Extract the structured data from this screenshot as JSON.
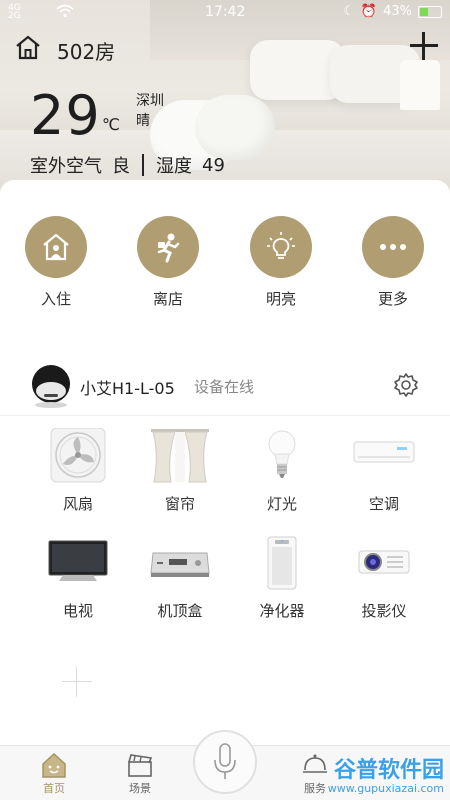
{
  "status_bar": {
    "network_top": "4G",
    "network_bottom": "2G",
    "time": "17:42",
    "battery": "43%",
    "battery_level": 0.43
  },
  "header": {
    "room": "502房"
  },
  "weather": {
    "temperature": "29",
    "unit": "℃",
    "city": "深圳",
    "condition": "晴",
    "air_label": "室外空气",
    "air_value": "良",
    "humidity_label": "湿度",
    "humidity_value": "49"
  },
  "scenes": [
    {
      "label": "入住",
      "icon": "house-person-icon"
    },
    {
      "label": "离店",
      "icon": "running-person-icon"
    },
    {
      "label": "明亮",
      "icon": "lightbulb-icon"
    },
    {
      "label": "更多",
      "icon": "more-dots-icon"
    }
  ],
  "device": {
    "name": "小艾H1-L-05",
    "status": "设备在线"
  },
  "appliances": [
    {
      "label": "风扇",
      "icon": "fan-icon"
    },
    {
      "label": "窗帘",
      "icon": "curtain-icon"
    },
    {
      "label": "灯光",
      "icon": "bulb-icon"
    },
    {
      "label": "空调",
      "icon": "air-conditioner-icon"
    },
    {
      "label": "电视",
      "icon": "tv-icon"
    },
    {
      "label": "机顶盒",
      "icon": "set-top-box-icon"
    },
    {
      "label": "净化器",
      "icon": "air-purifier-icon"
    },
    {
      "label": "投影仪",
      "icon": "projector-icon"
    }
  ],
  "nav": {
    "home": "首页",
    "scenes": "场景",
    "service": "服务"
  },
  "watermark": {
    "brand": "谷普软件园",
    "url": "www.gupuxiazai.com"
  },
  "colors": {
    "accent": "#b09e72",
    "active_nav": "#a8935f",
    "watermark": "#3aa0e8"
  }
}
